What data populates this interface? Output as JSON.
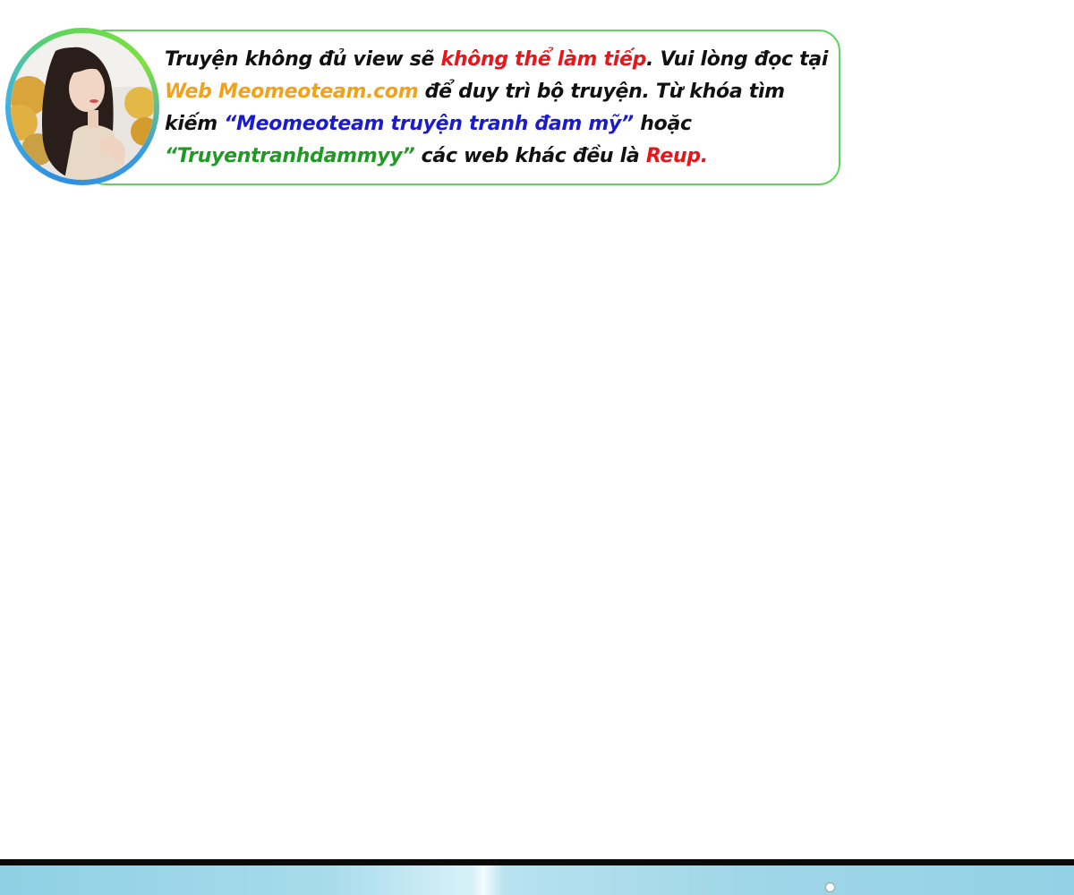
{
  "notice": {
    "segments": [
      {
        "text": "Truyện không đủ view sẽ ",
        "color": "#111111"
      },
      {
        "text": "không thể làm tiếp",
        "color": "#e8161b"
      },
      {
        "text": ". Vui lòng đọc tại ",
        "color": "#111111"
      },
      {
        "text": "Web Meomeoteam.com",
        "color": "#f2a11a"
      },
      {
        "text": " để duy trì bộ truyện. Từ khóa tìm kiếm ",
        "color": "#111111"
      },
      {
        "text": "“Meomeoteam truyện tranh đam mỹ”",
        "color": "#1a1ad6"
      },
      {
        "text": " hoặc ",
        "color": "#111111"
      },
      {
        "text": "“Truyentranhdammyy”",
        "color": "#1f9a24"
      },
      {
        "text": " các web khác đều là ",
        "color": "#111111"
      },
      {
        "text": "Reup.",
        "color": "#e8161b"
      }
    ]
  },
  "colors": {
    "bubble_border": "#5fd65a",
    "avatar_ring_blue": "#2f8fe0",
    "avatar_ring_green": "#5fd65a",
    "footer_bar": "#0a0a0a",
    "footer_sky": "#9fd6e8"
  },
  "icons": {
    "avatar": "avatar-photo-icon"
  }
}
